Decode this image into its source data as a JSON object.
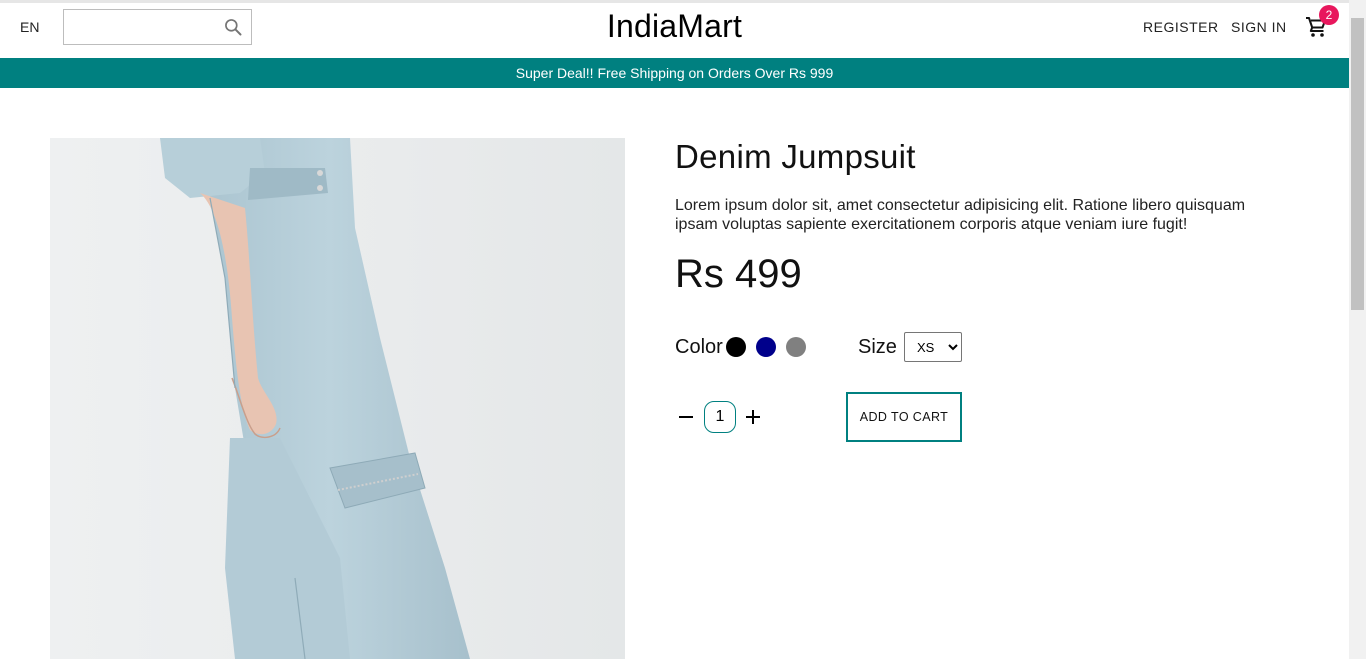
{
  "header": {
    "language": "EN",
    "search": {
      "value": "",
      "placeholder": ""
    },
    "logo": "IndiaMart",
    "register_label": "REGISTER",
    "signin_label": "SIGN IN",
    "cart_count": "2"
  },
  "announcement": "Super Deal!! Free Shipping on Orders Over Rs 999",
  "product": {
    "title": "Denim Jumpsuit",
    "description": "Lorem ipsum dolor sit, amet consectetur adipisicing elit. Ratione libero quisquam ipsam voluptas sapiente exercitationem corporis atque veniam iure fugit!",
    "price": "Rs 499",
    "color_label": "Color",
    "colors": [
      "#000000",
      "#00008b",
      "#808080"
    ],
    "size_label": "Size",
    "size_selected": "XS",
    "quantity": "1",
    "add_to_cart_label": "ADD TO CART"
  },
  "colors": {
    "accent": "#008080",
    "badge": "#e8175d"
  }
}
